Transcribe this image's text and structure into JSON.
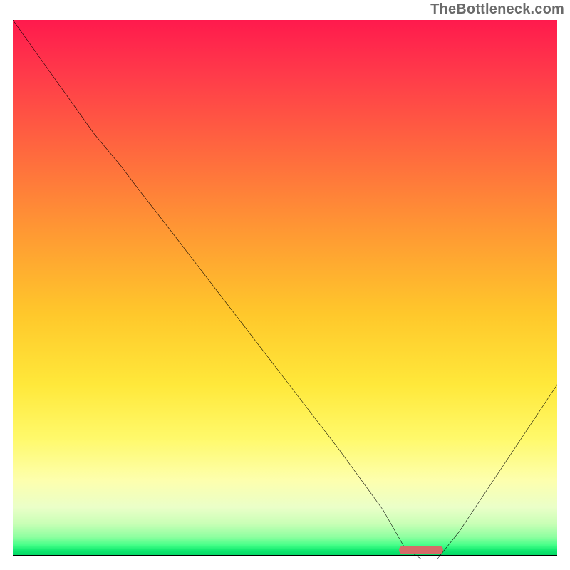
{
  "watermark": "TheBottleneck.com",
  "colors": {
    "gradient_top": "#ff1a4d",
    "gradient_mid1": "#ff9a33",
    "gradient_mid2": "#ffe83a",
    "gradient_bottom": "#00d463",
    "curve_stroke": "#000000",
    "marker_fill": "#d66b68",
    "watermark_text": "#6a6a6a"
  },
  "chart_data": {
    "type": "line",
    "title": "",
    "xlabel": "",
    "ylabel": "",
    "xlim": [
      0,
      100
    ],
    "ylim": [
      0,
      100
    ],
    "grid": false,
    "legend": false,
    "note": "Values estimated from pixel positions; y is percentage from bottom (0) to top (100). Curve descends from top-left, reaches a flat minimum near x≈72–78, then rises to the right edge. The flat segment is highlighted by a rounded marker.",
    "series": [
      {
        "name": "curve",
        "x": [
          0,
          5,
          10,
          15,
          20,
          23,
          30,
          40,
          50,
          60,
          68,
          72,
          75,
          78,
          82,
          88,
          94,
          100
        ],
        "y": [
          100,
          93,
          86,
          79,
          73,
          69,
          60,
          47,
          34,
          21,
          10,
          3,
          1,
          1,
          6,
          15,
          24,
          33
        ]
      }
    ],
    "marker": {
      "x_start": 71,
      "x_end": 79,
      "y": 1,
      "height_pct": 1.6
    },
    "background": {
      "type": "vertical_gradient",
      "stops": [
        {
          "pos": 0.0,
          "color": "#ff1a4d"
        },
        {
          "pos": 0.25,
          "color": "#ff6a3e"
        },
        {
          "pos": 0.55,
          "color": "#ffc82b"
        },
        {
          "pos": 0.78,
          "color": "#fff96a"
        },
        {
          "pos": 0.94,
          "color": "#c9ffb6"
        },
        {
          "pos": 1.0,
          "color": "#00d463"
        }
      ]
    }
  }
}
